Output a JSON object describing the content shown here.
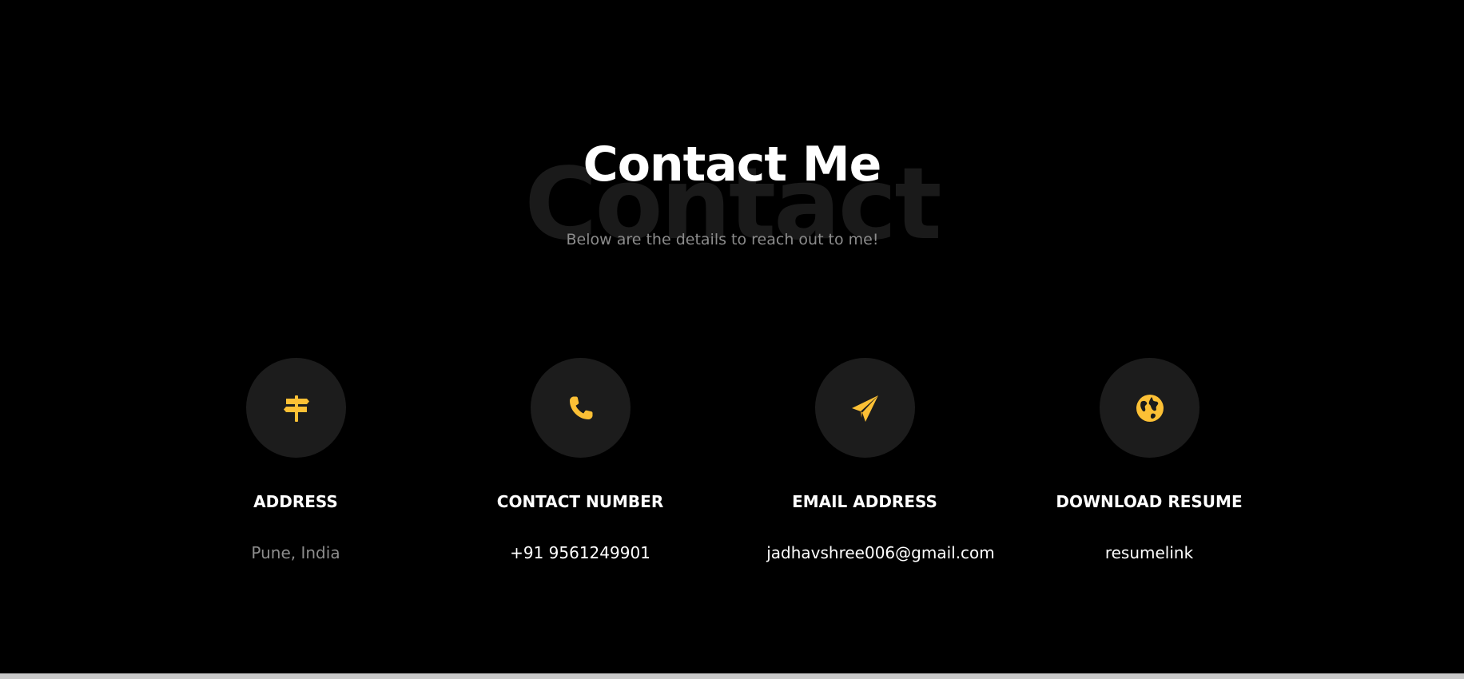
{
  "section": {
    "watermark": "Contact",
    "title": "Contact Me",
    "subtitle": "Below are the details to reach out to me!"
  },
  "contacts": [
    {
      "label": "ADDRESS",
      "value": "Pune, India",
      "icon": "signpost-icon"
    },
    {
      "label": "CONTACT NUMBER",
      "value": "+91 9561249901",
      "icon": "phone-icon"
    },
    {
      "label": "EMAIL ADDRESS",
      "value": "jadhavshree006@gmail.com",
      "icon": "paper-plane-icon"
    },
    {
      "label": "DOWNLOAD RESUME",
      "value": "resumelink",
      "icon": "globe-icon"
    }
  ],
  "colors": {
    "background": "#000000",
    "accent": "#fcc035",
    "icon_circle": "#1c1c1c",
    "watermark": "#1a1a1a",
    "muted_text": "#8c8c8c",
    "text": "#ffffff"
  }
}
